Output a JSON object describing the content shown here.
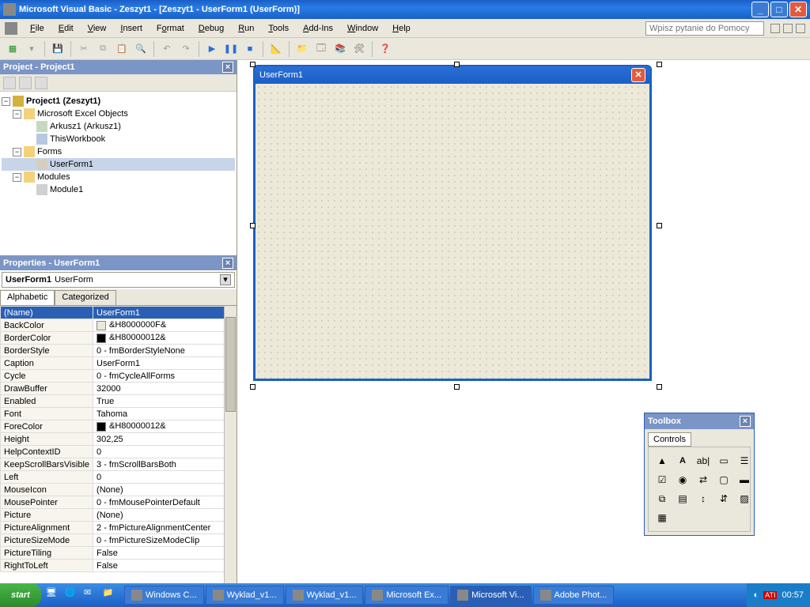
{
  "title": "Microsoft Visual Basic - Zeszyt1 - [Zeszyt1 - UserForm1 (UserForm)]",
  "menu": [
    "File",
    "Edit",
    "View",
    "Insert",
    "Format",
    "Debug",
    "Run",
    "Tools",
    "Add-Ins",
    "Window",
    "Help"
  ],
  "help_placeholder": "Wpisz pytanie do Pomocy",
  "project_pane_title": "Project - Project1",
  "tree": {
    "root": "Project1 (Zeszyt1)",
    "excel_objects": "Microsoft Excel Objects",
    "sheet": "Arkusz1 (Arkusz1)",
    "workbook": "ThisWorkbook",
    "forms": "Forms",
    "userform": "UserForm1",
    "modules": "Modules",
    "module1": "Module1"
  },
  "props_pane_title": "Properties - UserForm1",
  "props_combo_name": "UserForm1",
  "props_combo_type": "UserForm",
  "props_tabs": [
    "Alphabetic",
    "Categorized"
  ],
  "properties": [
    {
      "k": "(Name)",
      "v": "UserForm1",
      "sel": true
    },
    {
      "k": "BackColor",
      "v": "&H8000000F&",
      "swatch": "#ece9d8"
    },
    {
      "k": "BorderColor",
      "v": "&H80000012&",
      "swatch": "#000000"
    },
    {
      "k": "BorderStyle",
      "v": "0 - fmBorderStyleNone"
    },
    {
      "k": "Caption",
      "v": "UserForm1"
    },
    {
      "k": "Cycle",
      "v": "0 - fmCycleAllForms"
    },
    {
      "k": "DrawBuffer",
      "v": "32000"
    },
    {
      "k": "Enabled",
      "v": "True"
    },
    {
      "k": "Font",
      "v": "Tahoma"
    },
    {
      "k": "ForeColor",
      "v": "&H80000012&",
      "swatch": "#000000"
    },
    {
      "k": "Height",
      "v": "302,25"
    },
    {
      "k": "HelpContextID",
      "v": "0"
    },
    {
      "k": "KeepScrollBarsVisible",
      "v": "3 - fmScrollBarsBoth"
    },
    {
      "k": "Left",
      "v": "0"
    },
    {
      "k": "MouseIcon",
      "v": "(None)"
    },
    {
      "k": "MousePointer",
      "v": "0 - fmMousePointerDefault"
    },
    {
      "k": "Picture",
      "v": "(None)"
    },
    {
      "k": "PictureAlignment",
      "v": "2 - fmPictureAlignmentCenter"
    },
    {
      "k": "PictureSizeMode",
      "v": "0 - fmPictureSizeModeClip"
    },
    {
      "k": "PictureTiling",
      "v": "False"
    },
    {
      "k": "RightToLeft",
      "v": "False"
    }
  ],
  "form_caption": "UserForm1",
  "toolbox_title": "Toolbox",
  "toolbox_tab": "Controls",
  "taskbar": {
    "start": "start",
    "tasks": [
      "Windows C...",
      "Wyklad_v1...",
      "Wyklad_v1...",
      "Microsoft Ex...",
      "Microsoft Vi...",
      "Adobe Phot..."
    ],
    "active": 4,
    "clock": "00:57"
  }
}
